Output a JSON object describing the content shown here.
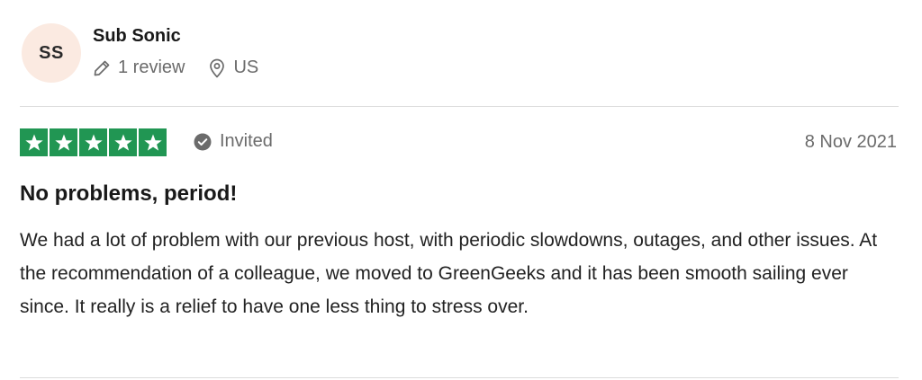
{
  "reviewer": {
    "initials": "SS",
    "name": "Sub Sonic",
    "review_count": "1 review",
    "country": "US",
    "review_icon": "pencil-icon",
    "location_icon": "location-pin-icon"
  },
  "review": {
    "rating": 5,
    "rating_max": 5,
    "status_label": "Invited",
    "status_icon": "check-circle-icon",
    "date": "8 Nov 2021",
    "title": "No problems, period!",
    "body": "We had a lot of problem with our previous host, with periodic slowdowns, outages, and other issues. At the recommendation of a colleague, we moved to GreenGeeks and it has been smooth sailing ever since. It really is a relief to have one less thing to stress over."
  },
  "colors": {
    "star_green": "#219653",
    "avatar_bg": "#fbeae1",
    "muted_text": "#6b6b6b"
  }
}
